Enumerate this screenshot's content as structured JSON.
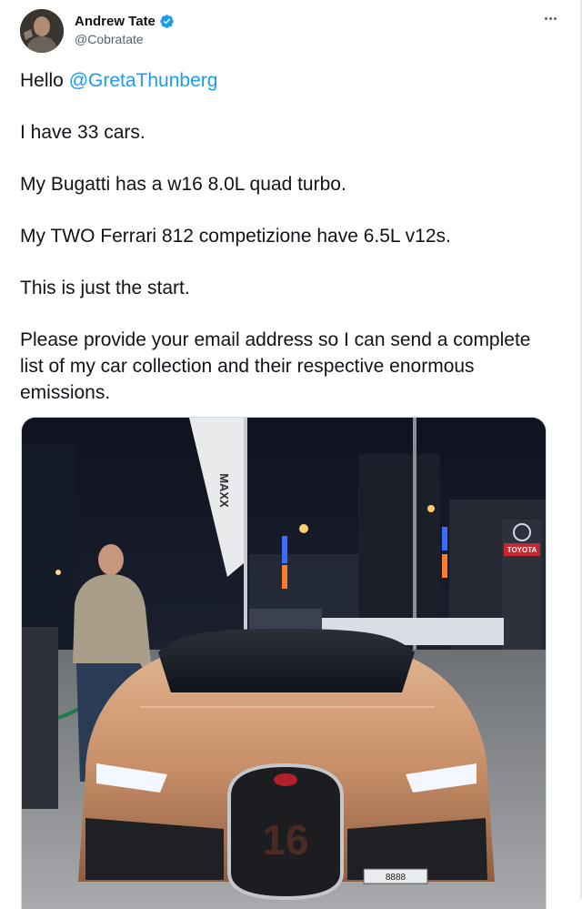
{
  "author": {
    "display_name": "Andrew Tate",
    "handle": "@Cobratate",
    "avatar_icon": "avatar-photo",
    "verified_icon": "verified-badge-icon",
    "verified_color": "#1d9bf0"
  },
  "menu": {
    "icon": "more-options-icon"
  },
  "tweet": {
    "greeting_prefix": "Hello ",
    "mention": "@GretaThunberg",
    "line1": "I have 33 cars.",
    "line2": "My Bugatti has a w16 8.0L quad turbo.",
    "line3": "My TWO Ferrari 812 competizione have 6.5L v12s.",
    "line4": "This is just the start.",
    "line5": "Please provide your email address so I can send a complete list of my car collection and their respective enormous emissions."
  },
  "media": {
    "image_icon": "car-photo",
    "banner_text": "MAXX",
    "sign_text": "TOYOTA",
    "grille_number": "16",
    "plate_text": "8888"
  },
  "colors": {
    "mention": "#1d9bf0",
    "text": "#0f1419",
    "secondary": "#536471"
  }
}
